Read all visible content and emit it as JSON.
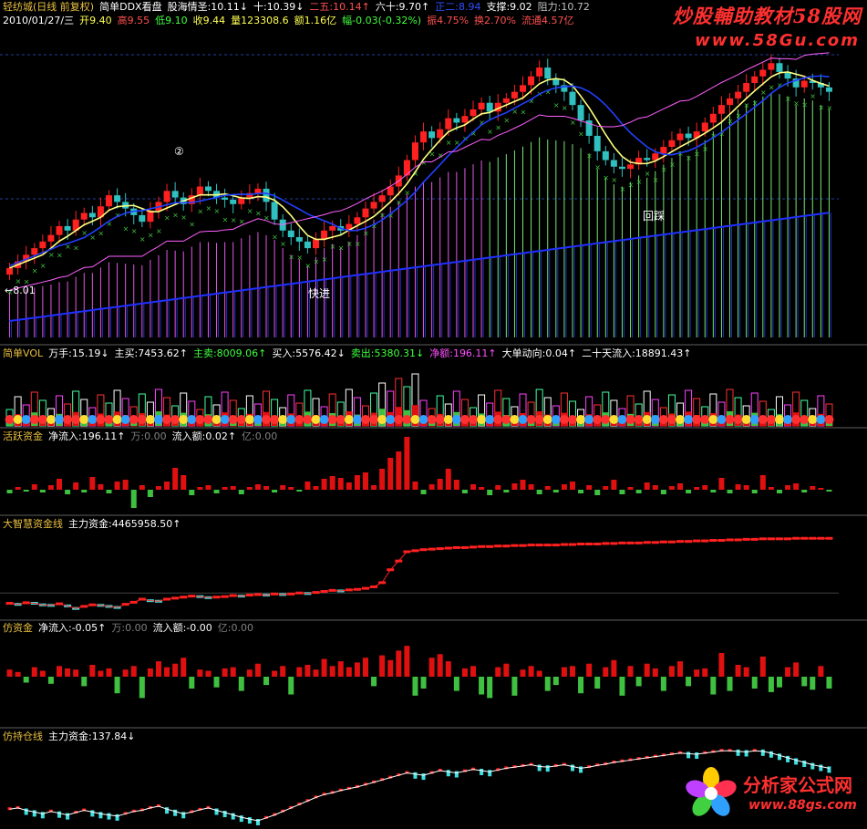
{
  "header": {
    "line1": [
      {
        "text": "轻纺城(日线 前复权)",
        "color": "#e8c040"
      },
      {
        "text": "简单DDX看盘",
        "color": "#ffffff"
      },
      {
        "text": "股海情圣:10.11↓",
        "color": "#ffffff"
      },
      {
        "text": "十:10.39↓",
        "color": "#ffffff"
      },
      {
        "text": "二五:10.14↑",
        "color": "#ff5050"
      },
      {
        "text": "六十:9.70↑",
        "color": "#ffffff"
      },
      {
        "text": "正二:8.94",
        "color": "#3050ff"
      },
      {
        "text": "支撑:9.02",
        "color": "#ffffff"
      },
      {
        "text": "阻力:10.72",
        "color": "#c0c0c0"
      }
    ],
    "line2": [
      {
        "text": "2010/01/27/三",
        "color": "#ffffff"
      },
      {
        "text": "开9.40",
        "color": "#ffff50"
      },
      {
        "text": "高9.55",
        "color": "#ff5050"
      },
      {
        "text": "低9.10",
        "color": "#40ff40"
      },
      {
        "text": "收9.44",
        "color": "#ffff50"
      },
      {
        "text": "量123308.6",
        "color": "#ffff50"
      },
      {
        "text": "额1.16亿",
        "color": "#ffff50"
      },
      {
        "text": "幅-0.03(-0.32%)",
        "color": "#40ff40"
      },
      {
        "text": "振4.75%",
        "color": "#ff5050"
      },
      {
        "text": "换2.70%",
        "color": "#ff5050"
      },
      {
        "text": "流通4.57亿",
        "color": "#ff5050"
      }
    ]
  },
  "watermark": {
    "title": "炒股輔助教材58股网",
    "url": "www.58Gu.com"
  },
  "logo": {
    "title": "分析家公式网",
    "url": "www.88gs.com"
  },
  "annotations": {
    "marker": "②",
    "fast_in": "快进",
    "pullback": "回踩",
    "low_label": "←8.01"
  },
  "panels": {
    "vol": {
      "name": "简单VOL",
      "labels": [
        {
          "text": "万手:15.19↓",
          "color": "#ffffff"
        },
        {
          "text": "主买:7453.62↑",
          "color": "#ffffff"
        },
        {
          "text": "主卖:8009.06↑",
          "color": "#40ff40"
        },
        {
          "text": "买入:5576.42↓",
          "color": "#ffffff"
        },
        {
          "text": "卖出:5380.31↓",
          "color": "#40ff40"
        },
        {
          "text": "净额:196.11↑",
          "color": "#ff50ff"
        },
        {
          "text": "大单动向:0.04↑",
          "color": "#ffffff"
        },
        {
          "text": "二十天流入:18891.43↑",
          "color": "#ffffff"
        }
      ]
    },
    "active": {
      "name": "活跃资金",
      "labels": [
        {
          "text": "净流入:196.11↑",
          "color": "#ffffff"
        },
        {
          "text": "万:0.00",
          "color": "#808080"
        },
        {
          "text": "流入额:0.02↑",
          "color": "#ffffff"
        },
        {
          "text": "亿:0.00",
          "color": "#808080"
        }
      ]
    },
    "wisdom": {
      "name": "大智慧资金线",
      "labels": [
        {
          "text": "主力资金:4465958.50↑",
          "color": "#ffffff"
        }
      ]
    },
    "fake": {
      "name": "仿资金",
      "labels": [
        {
          "text": "净流入:-0.05↑",
          "color": "#ffffff"
        },
        {
          "text": "万:0.00",
          "color": "#808080"
        },
        {
          "text": "流入额:-0.00",
          "color": "#ffffff"
        },
        {
          "text": "亿:0.00",
          "color": "#808080"
        }
      ]
    },
    "hold": {
      "name": "仿持仓线",
      "labels": [
        {
          "text": "主力资金:137.84↓",
          "color": "#ffffff"
        }
      ]
    }
  },
  "colors": {
    "up": "#ff2020",
    "down": "#30c0c0",
    "grid": "#404040",
    "ma5": "#ffff80",
    "ma10": "#2040ff",
    "band": "#ff60ff",
    "band2": "#80ff80",
    "flowRed": "#e01010",
    "flowGreen": "#40c040"
  },
  "chart_data": {
    "type": "candlestick",
    "instrument": "轻纺城",
    "period": "日线 前复权",
    "last_bar": {
      "date": "2010/01/27",
      "open": 9.4,
      "high": 9.55,
      "low": 9.1,
      "close": 9.44,
      "volume": 123308.6,
      "amount": "1.16亿",
      "change": -0.03,
      "change_pct": -0.32,
      "amplitude_pct": 4.75,
      "turnover_pct": 2.7,
      "float": "4.57亿"
    },
    "indicators": {
      "股海情圣": 10.11,
      "十": 10.39,
      "二五": 10.14,
      "六十": 9.7,
      "正二": 8.94,
      "支撑": 9.02,
      "阻力": 10.72
    },
    "closes": [
      8.1,
      8.25,
      8.4,
      8.55,
      8.7,
      8.85,
      9.05,
      8.95,
      9.2,
      9.35,
      9.25,
      9.5,
      9.75,
      9.6,
      9.45,
      9.3,
      9.15,
      9.4,
      9.6,
      9.85,
      9.7,
      9.55,
      9.75,
      9.95,
      9.85,
      9.7,
      9.65,
      9.55,
      9.7,
      9.8,
      9.9,
      9.6,
      9.2,
      8.95,
      8.8,
      8.7,
      8.55,
      8.75,
      8.95,
      9.05,
      8.95,
      9.1,
      9.25,
      9.45,
      9.6,
      9.75,
      9.95,
      10.2,
      10.55,
      10.95,
      11.2,
      11.05,
      11.25,
      11.5,
      11.4,
      11.55,
      11.7,
      11.85,
      11.65,
      11.85,
      11.95,
      12.1,
      12.25,
      12.45,
      12.65,
      12.4,
      12.25,
      12.1,
      11.8,
      11.45,
      11.1,
      10.75,
      10.55,
      10.4,
      10.35,
      10.45,
      10.6,
      10.55,
      10.7,
      10.85,
      11.0,
      11.15,
      11.05,
      11.2,
      11.4,
      11.6,
      11.8,
      11.95,
      12.1,
      12.3,
      12.45,
      12.6,
      12.75,
      12.55,
      12.4,
      12.2,
      12.35,
      12.3,
      12.2,
      12.1
    ],
    "active_flow": [
      -0.4,
      0.3,
      -0.2,
      0.6,
      -0.3,
      0.5,
      1.2,
      -0.5,
      0.8,
      -0.3,
      1.4,
      0.6,
      -0.4,
      0.9,
      1.1,
      -2.0,
      0.5,
      -0.8,
      0.4,
      0.9,
      2.4,
      1.6,
      -0.6,
      0.3,
      0.5,
      -0.4,
      0.3,
      0.4,
      -0.5,
      0.3,
      0.6,
      0.4,
      -0.3,
      0.5,
      0.3,
      -0.2,
      0.9,
      0.4,
      1.2,
      1.5,
      1.3,
      0.8,
      1.6,
      1.9,
      0.5,
      2.3,
      3.5,
      4.2,
      5.8,
      0.9,
      -0.5,
      0.6,
      1.2,
      2.3,
      1.1,
      -0.4,
      0.6,
      0.3,
      -0.6,
      0.5,
      -0.3,
      0.7,
      1.1,
      0.6,
      -0.5,
      0.4,
      -0.3,
      0.6,
      0.9,
      -0.4,
      0.5,
      -0.6,
      0.4,
      1.1,
      -0.5,
      0.3,
      -0.4,
      0.8,
      0.5,
      -0.5,
      0.4,
      0.7,
      -0.4,
      0.3,
      0.5,
      -0.3,
      1.3,
      -0.4,
      0.6,
      0.5,
      -0.4,
      1.6,
      0.3,
      -0.4,
      0.5,
      0.7,
      -0.3,
      0.4,
      0.2,
      -0.2
    ],
    "fake_flow": [
      0.6,
      0.4,
      -0.5,
      0.8,
      0.5,
      -0.6,
      0.9,
      0.7,
      0.6,
      -0.8,
      1.0,
      0.5,
      0.7,
      -1.4,
      0.6,
      0.9,
      -1.8,
      0.7,
      1.3,
      0.8,
      1.1,
      1.6,
      -1.0,
      0.6,
      0.5,
      -0.9,
      0.7,
      0.8,
      -1.2,
      0.6,
      1.1,
      -0.7,
      0.5,
      0.9,
      -1.5,
      0.8,
      1.0,
      0.6,
      1.5,
      0.9,
      1.3,
      0.8,
      1.2,
      1.6,
      -0.8,
      1.8,
      1.4,
      2.2,
      2.6,
      -1.6,
      -1.0,
      1.6,
      1.9,
      1.3,
      -1.2,
      0.7,
      0.9,
      -1.5,
      -1.8,
      0.8,
      1.1,
      -1.6,
      0.6,
      0.9,
      0.5,
      -1.2,
      -0.7,
      0.8,
      0.9,
      -1.4,
      1.1,
      -1.0,
      0.8,
      1.4,
      -1.6,
      0.9,
      -0.8,
      1.1,
      0.7,
      -1.2,
      0.9,
      1.3,
      -0.8,
      0.6,
      0.7,
      -1.5,
      2.0,
      -1.2,
      1.0,
      0.8,
      -1.0,
      1.7,
      -1.3,
      -0.9,
      0.8,
      1.2,
      -0.8,
      -1.1,
      0.9,
      -1.0
    ],
    "main_line": [
      -0.2,
      -0.22,
      -0.19,
      -0.2,
      -0.23,
      -0.24,
      -0.21,
      -0.25,
      -0.3,
      -0.26,
      -0.23,
      -0.24,
      -0.26,
      -0.28,
      -0.22,
      -0.18,
      -0.12,
      -0.15,
      -0.16,
      -0.12,
      -0.1,
      -0.08,
      -0.06,
      -0.07,
      -0.09,
      -0.08,
      -0.07,
      -0.05,
      -0.06,
      -0.04,
      -0.03,
      -0.04,
      -0.02,
      -0.03,
      -0.02,
      0.0,
      -0.01,
      0.01,
      0.03,
      0.05,
      0.04,
      0.06,
      0.07,
      0.09,
      0.12,
      0.2,
      0.45,
      0.62,
      0.8,
      0.82,
      0.84,
      0.85,
      0.86,
      0.87,
      0.88,
      0.88,
      0.89,
      0.9,
      0.9,
      0.91,
      0.91,
      0.92,
      0.92,
      0.93,
      0.93,
      0.93,
      0.93,
      0.94,
      0.94,
      0.95,
      0.95,
      0.95,
      0.96,
      0.96,
      0.97,
      0.97,
      0.97,
      0.98,
      0.98,
      0.99,
      0.99,
      1.0,
      1.0,
      1.01,
      1.01,
      1.02,
      1.02,
      1.03,
      1.03,
      1.04,
      1.04,
      1.05,
      1.05,
      1.05,
      1.05,
      1.06,
      1.06,
      1.06,
      1.06,
      1.06
    ],
    "hold_line": [
      0.2,
      0.22,
      0.18,
      0.15,
      0.12,
      0.16,
      0.13,
      0.1,
      0.14,
      0.18,
      0.15,
      0.12,
      0.1,
      0.08,
      0.12,
      0.16,
      0.18,
      0.22,
      0.25,
      0.2,
      0.16,
      0.12,
      0.15,
      0.19,
      0.22,
      0.18,
      0.14,
      0.1,
      0.06,
      0.03,
      0.0,
      0.05,
      0.1,
      0.16,
      0.22,
      0.28,
      0.34,
      0.4,
      0.45,
      0.48,
      0.52,
      0.55,
      0.58,
      0.62,
      0.66,
      0.7,
      0.74,
      0.78,
      0.82,
      0.8,
      0.78,
      0.82,
      0.86,
      0.84,
      0.82,
      0.85,
      0.88,
      0.86,
      0.84,
      0.87,
      0.9,
      0.92,
      0.94,
      0.96,
      0.93,
      0.92,
      0.94,
      0.96,
      0.93,
      0.9,
      0.92,
      0.95,
      0.97,
      1.0,
      1.02,
      1.04,
      1.06,
      1.08,
      1.1,
      1.12,
      1.14,
      1.16,
      1.15,
      1.14,
      1.16,
      1.18,
      1.2,
      1.2,
      1.19,
      1.18,
      1.2,
      1.19,
      1.16,
      1.12,
      1.08,
      1.04,
      1.0,
      0.96,
      0.93,
      0.9
    ]
  }
}
